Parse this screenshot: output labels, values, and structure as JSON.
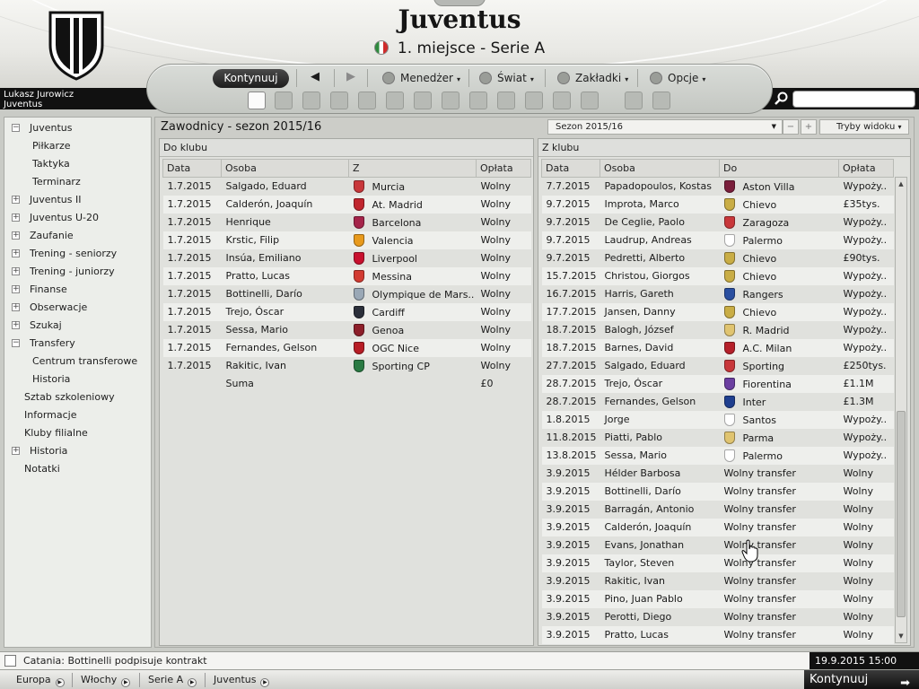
{
  "header": {
    "club_name": "Juventus",
    "league_position": "1. miejsce - Serie A"
  },
  "manager": {
    "name": "Lukasz Jurowicz",
    "club": "Juventus"
  },
  "toolbar": {
    "continue": "Kontynuuj",
    "menus": [
      "Menedżer",
      "Świat",
      "Zakładki",
      "Opcje"
    ],
    "caret": "▾"
  },
  "sidebar": {
    "items": [
      {
        "label": "Juventus",
        "expander": "−"
      },
      {
        "label": "Piłkarze"
      },
      {
        "label": "Taktyka"
      },
      {
        "label": "Terminarz"
      },
      {
        "label": "Juventus II",
        "expander": "+"
      },
      {
        "label": "Juventus U-20",
        "expander": "+"
      },
      {
        "label": "Zaufanie",
        "expander": "+"
      },
      {
        "label": "Trening - seniorzy",
        "expander": "+"
      },
      {
        "label": "Trening - juniorzy",
        "expander": "+"
      },
      {
        "label": "Finanse",
        "expander": "+"
      },
      {
        "label": "Obserwacje",
        "expander": "+"
      },
      {
        "label": "Szukaj",
        "expander": "+"
      },
      {
        "label": "Transfery",
        "expander": "−"
      },
      {
        "label": "Centrum transferowe"
      },
      {
        "label": "Historia"
      },
      {
        "label": "Sztab szkoleniowy"
      },
      {
        "label": "Informacje"
      },
      {
        "label": "Kluby filialne"
      },
      {
        "label": "Historia",
        "expander": "+"
      },
      {
        "label": "Notatki"
      }
    ]
  },
  "main": {
    "title": "Zawodnicy - sezon 2015/16",
    "season_select": "Sezon 2015/16",
    "view_modes": "Tryby widoku",
    "minus": "−",
    "plus": "+"
  },
  "incoming": {
    "heading": "Do klubu",
    "columns": [
      "Data",
      "Osoba",
      "Z",
      "Opłata"
    ],
    "rows": [
      {
        "date": "1.7.2015",
        "person": "Salgado, Eduard",
        "club": "Murcia",
        "fee": "Wolny",
        "crest": "#c8373a"
      },
      {
        "date": "1.7.2015",
        "person": "Calderón, Joaquín",
        "club": "At. Madrid",
        "fee": "Wolny",
        "crest": "#c0262e"
      },
      {
        "date": "1.7.2015",
        "person": "Henrique",
        "club": "Barcelona",
        "fee": "Wolny",
        "crest": "#a5244a"
      },
      {
        "date": "1.7.2015",
        "person": "Krstic, Filip",
        "club": "Valencia",
        "fee": "Wolny",
        "crest": "#e89a1d"
      },
      {
        "date": "1.7.2015",
        "person": "Insúa, Emiliano",
        "club": "Liverpool",
        "fee": "Wolny",
        "crest": "#c8102e"
      },
      {
        "date": "1.7.2015",
        "person": "Pratto, Lucas",
        "club": "Messina",
        "fee": "Wolny",
        "crest": "#d23b32"
      },
      {
        "date": "1.7.2015",
        "person": "Bottinelli, Darío",
        "club": "Olympique de Mars..",
        "fee": "Wolny",
        "crest": "#9aa8b6"
      },
      {
        "date": "1.7.2015",
        "person": "Trejo, Óscar",
        "club": "Cardiff",
        "fee": "Wolny",
        "crest": "#2b2f3a"
      },
      {
        "date": "1.7.2015",
        "person": "Sessa, Mario",
        "club": "Genoa",
        "fee": "Wolny",
        "crest": "#8d1f2a"
      },
      {
        "date": "1.7.2015",
        "person": "Fernandes, Gelson",
        "club": "OGC Nice",
        "fee": "Wolny",
        "crest": "#b71d25"
      },
      {
        "date": "1.7.2015",
        "person": "Rakitic, Ivan",
        "club": "Sporting CP",
        "fee": "Wolny",
        "crest": "#2a7a43"
      }
    ],
    "sum_label": "Suma",
    "sum_value": "£0"
  },
  "outgoing": {
    "heading": "Z klubu",
    "columns": [
      "Data",
      "Osoba",
      "Do",
      "Opłata"
    ],
    "rows": [
      {
        "date": "7.7.2015",
        "person": "Papadopoulos, Kostas",
        "club": "Aston Villa",
        "fee": "Wypoży..",
        "crest": "#7a1e3b"
      },
      {
        "date": "9.7.2015",
        "person": "Improta, Marco",
        "club": "Chievo",
        "fee": "£35tys.",
        "crest": "#c9ad45"
      },
      {
        "date": "9.7.2015",
        "person": "De Ceglie, Paolo",
        "club": "Zaragoza",
        "fee": "Wypoży..",
        "crest": "#c8373a"
      },
      {
        "date": "9.7.2015",
        "person": "Laudrup, Andreas",
        "club": "Palermo",
        "fee": "Wypoży..",
        "crest": "#ffffff"
      },
      {
        "date": "9.7.2015",
        "person": "Pedretti, Alberto",
        "club": "Chievo",
        "fee": "£90tys.",
        "crest": "#c9ad45"
      },
      {
        "date": "15.7.2015",
        "person": "Christou, Giorgos",
        "club": "Chievo",
        "fee": "Wypoży..",
        "crest": "#c9ad45"
      },
      {
        "date": "16.7.2015",
        "person": "Harris, Gareth",
        "club": "Rangers",
        "fee": "Wypoży..",
        "crest": "#2a4fa0"
      },
      {
        "date": "17.7.2015",
        "person": "Jansen, Danny",
        "club": "Chievo",
        "fee": "Wypoży..",
        "crest": "#c9ad45"
      },
      {
        "date": "18.7.2015",
        "person": "Balogh, József",
        "club": "R. Madrid",
        "fee": "Wypoży..",
        "crest": "#e0c470"
      },
      {
        "date": "18.7.2015",
        "person": "Barnes, David",
        "club": "A.C. Milan",
        "fee": "Wypoży..",
        "crest": "#b5202a"
      },
      {
        "date": "27.7.2015",
        "person": "Salgado, Eduard",
        "club": "Sporting",
        "fee": "£250tys.",
        "crest": "#c8373a"
      },
      {
        "date": "28.7.2015",
        "person": "Trejo, Óscar",
        "club": "Fiorentina",
        "fee": "£1.1M",
        "crest": "#6b3fa0"
      },
      {
        "date": "28.7.2015",
        "person": "Fernandes, Gelson",
        "club": "Inter",
        "fee": "£1.3M",
        "crest": "#1f3f8f"
      },
      {
        "date": "1.8.2015",
        "person": "Jorge",
        "club": "Santos",
        "fee": "Wypoży..",
        "crest": "#ffffff"
      },
      {
        "date": "11.8.2015",
        "person": "Piatti, Pablo",
        "club": "Parma",
        "fee": "Wypoży..",
        "crest": "#e0c470"
      },
      {
        "date": "13.8.2015",
        "person": "Sessa, Mario",
        "club": "Palermo",
        "fee": "Wypoży..",
        "crest": "#ffffff"
      },
      {
        "date": "3.9.2015",
        "person": "Hélder Barbosa",
        "club": "Wolny transfer",
        "fee": "Wolny"
      },
      {
        "date": "3.9.2015",
        "person": "Bottinelli, Darío",
        "club": "Wolny transfer",
        "fee": "Wolny"
      },
      {
        "date": "3.9.2015",
        "person": "Barragán, Antonio",
        "club": "Wolny transfer",
        "fee": "Wolny"
      },
      {
        "date": "3.9.2015",
        "person": "Calderón, Joaquín",
        "club": "Wolny transfer",
        "fee": "Wolny"
      },
      {
        "date": "3.9.2015",
        "person": "Evans, Jonathan",
        "club": "Wolny transfer",
        "fee": "Wolny"
      },
      {
        "date": "3.9.2015",
        "person": "Taylor, Steven",
        "club": "Wolny transfer",
        "fee": "Wolny"
      },
      {
        "date": "3.9.2015",
        "person": "Rakitic, Ivan",
        "club": "Wolny transfer",
        "fee": "Wolny"
      },
      {
        "date": "3.9.2015",
        "person": "Pino, Juan Pablo",
        "club": "Wolny transfer",
        "fee": "Wolny"
      },
      {
        "date": "3.9.2015",
        "person": "Perotti, Diego",
        "club": "Wolny transfer",
        "fee": "Wolny"
      },
      {
        "date": "3.9.2015",
        "person": "Pratto, Lucas",
        "club": "Wolny transfer",
        "fee": "Wolny"
      }
    ]
  },
  "status": {
    "news": "Catania: Bottinelli podpisuje kontrakt",
    "datetime": "19.9.2015 15:00"
  },
  "breadcrumbs": [
    "Europa",
    "Włochy",
    "Serie A",
    "Juventus"
  ],
  "continue_bottom": "Kontynuuj"
}
